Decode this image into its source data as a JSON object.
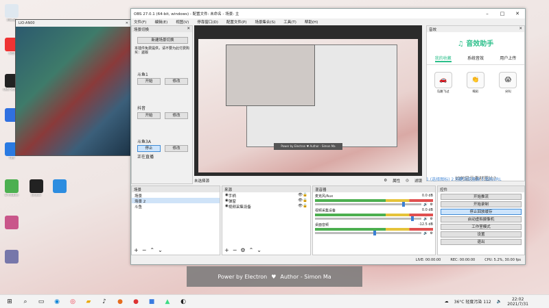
{
  "desktop": {
    "icons": [
      {
        "label": "回收站",
        "color": "#dfe8f0"
      },
      {
        "label": "抖音",
        "color": "#e33"
      },
      {
        "label": "OBS Studio",
        "color": "#222"
      },
      {
        "label": "",
        "color": "#3070e0"
      },
      {
        "label": "TIM",
        "color": "#2a7ae2"
      },
      {
        "label": "E-mobile",
        "color": "#4caf50"
      },
      {
        "label": "Jinyou",
        "color": "#222"
      },
      {
        "label": "",
        "color": "#2d8de0"
      },
      {
        "label": "",
        "color": "#c9568a"
      },
      {
        "label": "",
        "color": "#7777aa"
      }
    ]
  },
  "game": {
    "title": "LIO-AN00"
  },
  "obs": {
    "title": "OBS 27.0.1 (64-bit, windows) - 配置文件: 未命名 - 场景: 主",
    "menu": [
      "文件(F)",
      "编辑(E)",
      "视图(V)",
      "停靠窗口(D)",
      "配置文件(P)",
      "场景集合(S)",
      "工具(T)",
      "帮助(H)"
    ],
    "dock": {
      "title": "场景切换",
      "add_btn": "新建场景切换",
      "note": "本插件免费提供，请不要为此付费购买：盗版",
      "g1": "斗鱼1",
      "start": "开始",
      "modify": "修改",
      "g2": "抖音",
      "g3": "斗鱼3A",
      "stop": "停止",
      "live": "正在直播"
    },
    "sfx": {
      "panel": "音效",
      "brand": "音效助手",
      "tabs": [
        "我的收藏",
        "系统音效",
        "用户上传"
      ],
      "cards": [
        {
          "label": "马路飞过",
          "glyph": "🚗"
        },
        {
          "label": "喝彩",
          "glyph": "👏"
        },
        {
          "label": "尖叫",
          "glyph": "😱"
        }
      ],
      "question": "如何显示素材图片?",
      "steps": "1.(选择图标) 2.创建浏览器源 3.粘贴URL"
    },
    "under_preview": {
      "left": "未选择源",
      "props": "属性",
      "filters": "滤镜"
    },
    "scenes": {
      "title": "场景",
      "items": [
        "场景",
        "场景 2",
        "斗鱼"
      ]
    },
    "sources": {
      "title": "来源",
      "items": [
        "手柄",
        "弹窗",
        "视频采集设备"
      ]
    },
    "mixer": {
      "title": "混音器",
      "channels": [
        {
          "name": "麦克风/Aux",
          "db": "0.0 dB",
          "level": 0.82
        },
        {
          "name": "视频采集设备",
          "db": "0.0 dB",
          "level": 0.9
        },
        {
          "name": "桌面音频",
          "db": "-12.5 dB",
          "level": 0.55
        }
      ]
    },
    "controls": {
      "title": "控件",
      "buttons": [
        "开始推流",
        "开始录制",
        "停止回放缓存",
        "启动虚拟摄像机",
        "工作室模式",
        "设置",
        "退出"
      ],
      "active": 2
    },
    "status": {
      "live": "LIVE: 00:00:00",
      "rec": "REC: 00:00:00",
      "cpu": "CPU: 5.2%, 30.00 fps"
    }
  },
  "electron": {
    "text": "Power by Electron",
    "author": "Author - Simon Ma"
  },
  "taskbar": {
    "weather": "36°C  轻度污染 112",
    "time": "22:02",
    "date": "2021/7/31"
  }
}
